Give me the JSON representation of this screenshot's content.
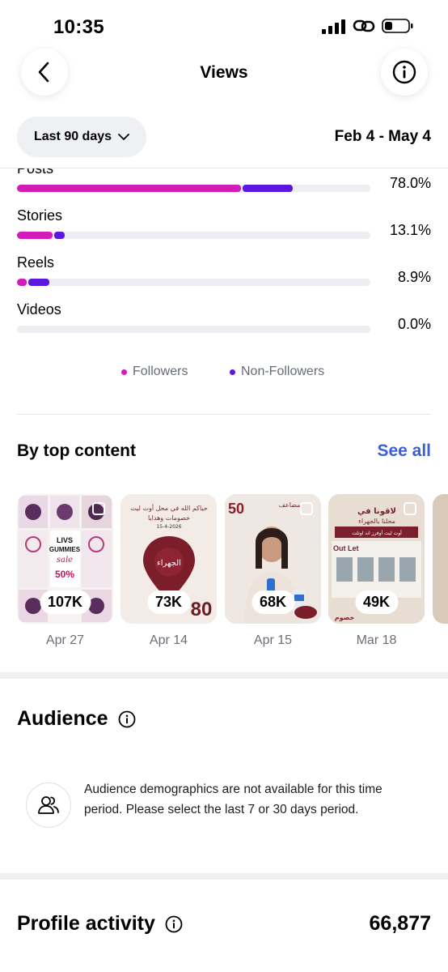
{
  "status_bar": {
    "time": "10:35"
  },
  "header": {
    "title": "Views",
    "back_icon": "chevron-left-icon",
    "info_icon": "info-icon"
  },
  "filter": {
    "range_label": "Last 90 days",
    "date_range": "Feb 4 - May 4"
  },
  "breakdown": {
    "items": [
      {
        "label": "Posts",
        "percent": "78.0%",
        "followers_frac": 0.635,
        "nonfollowers_frac": 0.14
      },
      {
        "label": "Stories",
        "percent": "13.1%",
        "followers_frac": 0.1,
        "nonfollowers_frac": 0.03
      },
      {
        "label": "Reels",
        "percent": "8.9%",
        "followers_frac": 0.027,
        "nonfollowers_frac": 0.06
      },
      {
        "label": "Videos",
        "percent": "0.0%",
        "followers_frac": 0.0,
        "nonfollowers_frac": 0.0
      }
    ],
    "legend": {
      "followers": "Followers",
      "non_followers": "Non-Followers"
    },
    "colors": {
      "followers": "#d21bb8",
      "non_followers": "#5b16e0"
    }
  },
  "top_content": {
    "title": "By top content",
    "see_all": "See all",
    "items": [
      {
        "count": "107K",
        "date": "Apr 27",
        "overlay_texts": [
          "LIVS",
          "GUMMIES",
          "sale",
          "50%"
        ]
      },
      {
        "count": "73K",
        "date": "Apr 14",
        "overlay_texts": [
          "حياكم الله في محل أوت ليت",
          "خصومات وهدايا",
          "15-4-2026",
          "الجهراء",
          "80"
        ]
      },
      {
        "count": "68K",
        "date": "Apr 15",
        "overlay_texts": [
          "50",
          "مضاعف"
        ]
      },
      {
        "count": "49K",
        "date": "Mar 18",
        "overlay_texts": [
          "لاقونا في",
          "محلنا بالجهراء",
          "أوت ليت أوفرز اند اوتلت",
          "Out Let",
          "خصوم"
        ]
      }
    ]
  },
  "audience": {
    "title": "Audience",
    "message": "Audience demographics are not available for this time period. Please select the last 7 or 30 days period."
  },
  "profile_activity": {
    "title": "Profile activity",
    "value": "66,877"
  }
}
